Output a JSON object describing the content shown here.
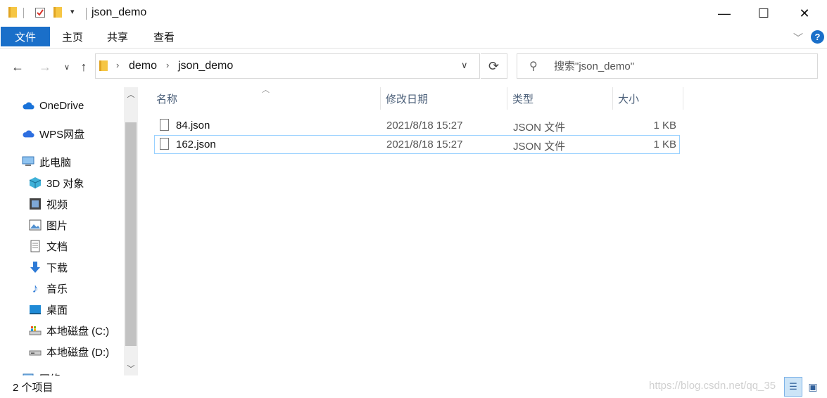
{
  "window": {
    "title": "json_demo",
    "controls": {
      "minimize": "—",
      "maximize": "☐",
      "close": "✕"
    }
  },
  "ribbon": {
    "tabs": [
      "文件",
      "主页",
      "共享",
      "查看"
    ],
    "active_tab": "文件",
    "accent_color": "#1a6fc9",
    "help_label": "?"
  },
  "address": {
    "breadcrumbs": [
      "demo",
      "json_demo"
    ],
    "search_placeholder": "搜索\"json_demo\""
  },
  "nav_pane": {
    "items": [
      {
        "label": "OneDrive",
        "icon": "cloud-icon"
      },
      {
        "label": "WPS网盘",
        "icon": "cloud-icon"
      },
      {
        "label": "此电脑",
        "icon": "computer-icon"
      },
      {
        "label": "3D 对象",
        "icon": "cube-icon"
      },
      {
        "label": "视频",
        "icon": "film-icon"
      },
      {
        "label": "图片",
        "icon": "picture-icon"
      },
      {
        "label": "文档",
        "icon": "document-icon"
      },
      {
        "label": "下载",
        "icon": "download-icon"
      },
      {
        "label": "音乐",
        "icon": "music-icon"
      },
      {
        "label": "桌面",
        "icon": "desktop-icon"
      },
      {
        "label": "本地磁盘 (C:)",
        "icon": "drive-icon"
      },
      {
        "label": "本地磁盘 (D:)",
        "icon": "drive-icon"
      },
      {
        "label": "网络",
        "icon": "network-icon"
      }
    ]
  },
  "file_list": {
    "columns": [
      "名称",
      "修改日期",
      "类型",
      "大小"
    ],
    "rows": [
      {
        "name": "84.json",
        "modified": "2021/8/18 15:27",
        "type": "JSON 文件",
        "size": "1 KB"
      },
      {
        "name": "162.json",
        "modified": "2021/8/18 15:27",
        "type": "JSON 文件",
        "size": "1 KB"
      }
    ],
    "selected_row": 1
  },
  "status_bar": {
    "item_count": "2 个项目",
    "watermark": "https://blog.csdn.net/qq_35"
  }
}
